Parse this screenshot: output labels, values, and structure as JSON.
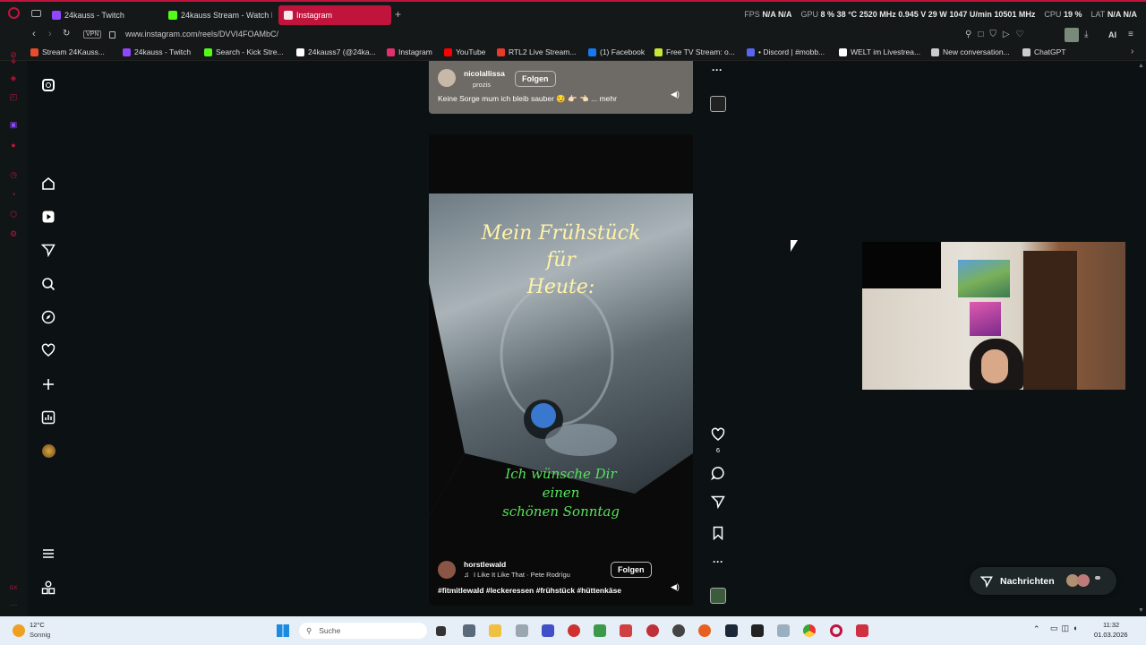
{
  "browser": {
    "tabs": [
      {
        "label": "24kauss - Twitch",
        "color": "#9146ff"
      },
      {
        "label": "24kauss Stream - Watch I",
        "color": "#53fc18"
      },
      {
        "label": "Instagram",
        "color": "#e1306c"
      }
    ],
    "new_tab": "+",
    "url": "www.instagram.com/reels/DVVI4FOAMbC/",
    "vpn_label": "VPN",
    "stats": {
      "fps_label": "FPS",
      "fps": "N/A",
      "fps2": "N/A",
      "gpu_label": "GPU",
      "gpu_load": "8 %",
      "gpu_temp": "38 °C",
      "gpu_clock": "2520 MHz",
      "gpu_volt": "0.945 V",
      "gpu_power": "29 W",
      "gpu_fan": "1047 U/min",
      "gpu_mem": "10501 MHz",
      "cpu_label": "CPU",
      "cpu_load": "19 %",
      "lat_label": "LAT",
      "lat1": "N/A",
      "lat2": "N/A"
    },
    "ai_label": "AI",
    "bookmarks": [
      {
        "label": "Stream 24Kauss...",
        "color": "#e84c2a"
      },
      {
        "label": "24kauss - Twitch",
        "color": "#9146ff"
      },
      {
        "label": "Search - Kick Stre...",
        "color": "#53fc18"
      },
      {
        "label": "24kauss7 (@24ka...",
        "color": "#ffffff"
      },
      {
        "label": "Instagram",
        "color": "#e1306c"
      },
      {
        "label": "YouTube",
        "color": "#ff0000"
      },
      {
        "label": "RTL2 Live Stream...",
        "color": "#e8392b"
      },
      {
        "label": "(1) Facebook",
        "color": "#1877f2"
      },
      {
        "label": "Free TV Stream: o...",
        "color": "#c8e635"
      },
      {
        "label": "• Discord | #mobb...",
        "color": "#5865f2"
      },
      {
        "label": "WELT im Livestrea...",
        "color": "#ffffff"
      },
      {
        "label": "New conversation...",
        "color": "#cccccc"
      },
      {
        "label": "ChatGPT",
        "color": "#cccccc"
      }
    ]
  },
  "reel_top": {
    "username": "nicolallissa",
    "subline": "prozis",
    "follow": "Folgen",
    "caption": "Keine Sorge mum ich bleib sauber 😏 👉🏻 👈🏻 ... mehr",
    "more": "···"
  },
  "reel_main": {
    "overlay_top": [
      "Mein Frühstück",
      "für",
      "Heute:"
    ],
    "overlay_bottom": [
      "Ich wünsche Dir",
      "einen",
      "schönen Sonntag"
    ],
    "username": "horstlewald",
    "music": "I Like It Like That · Pete Rodrígu",
    "follow": "Folgen",
    "caption": "#fitmitlewald #leckeressen #frühstück #hüttenkäse",
    "likes": "6",
    "more": "···"
  },
  "messages": {
    "label": "Nachrichten"
  },
  "taskbar": {
    "weather_temp": "12°C",
    "weather_desc": "Sonnig",
    "search_placeholder": "Suche",
    "time": "11:32",
    "date": "01.03.2026"
  },
  "colors": {
    "accent": "#c0143c",
    "follow_border": "#bbbbbb",
    "overlay_yellow": "#fff2a8",
    "overlay_green": "#57e35a"
  }
}
